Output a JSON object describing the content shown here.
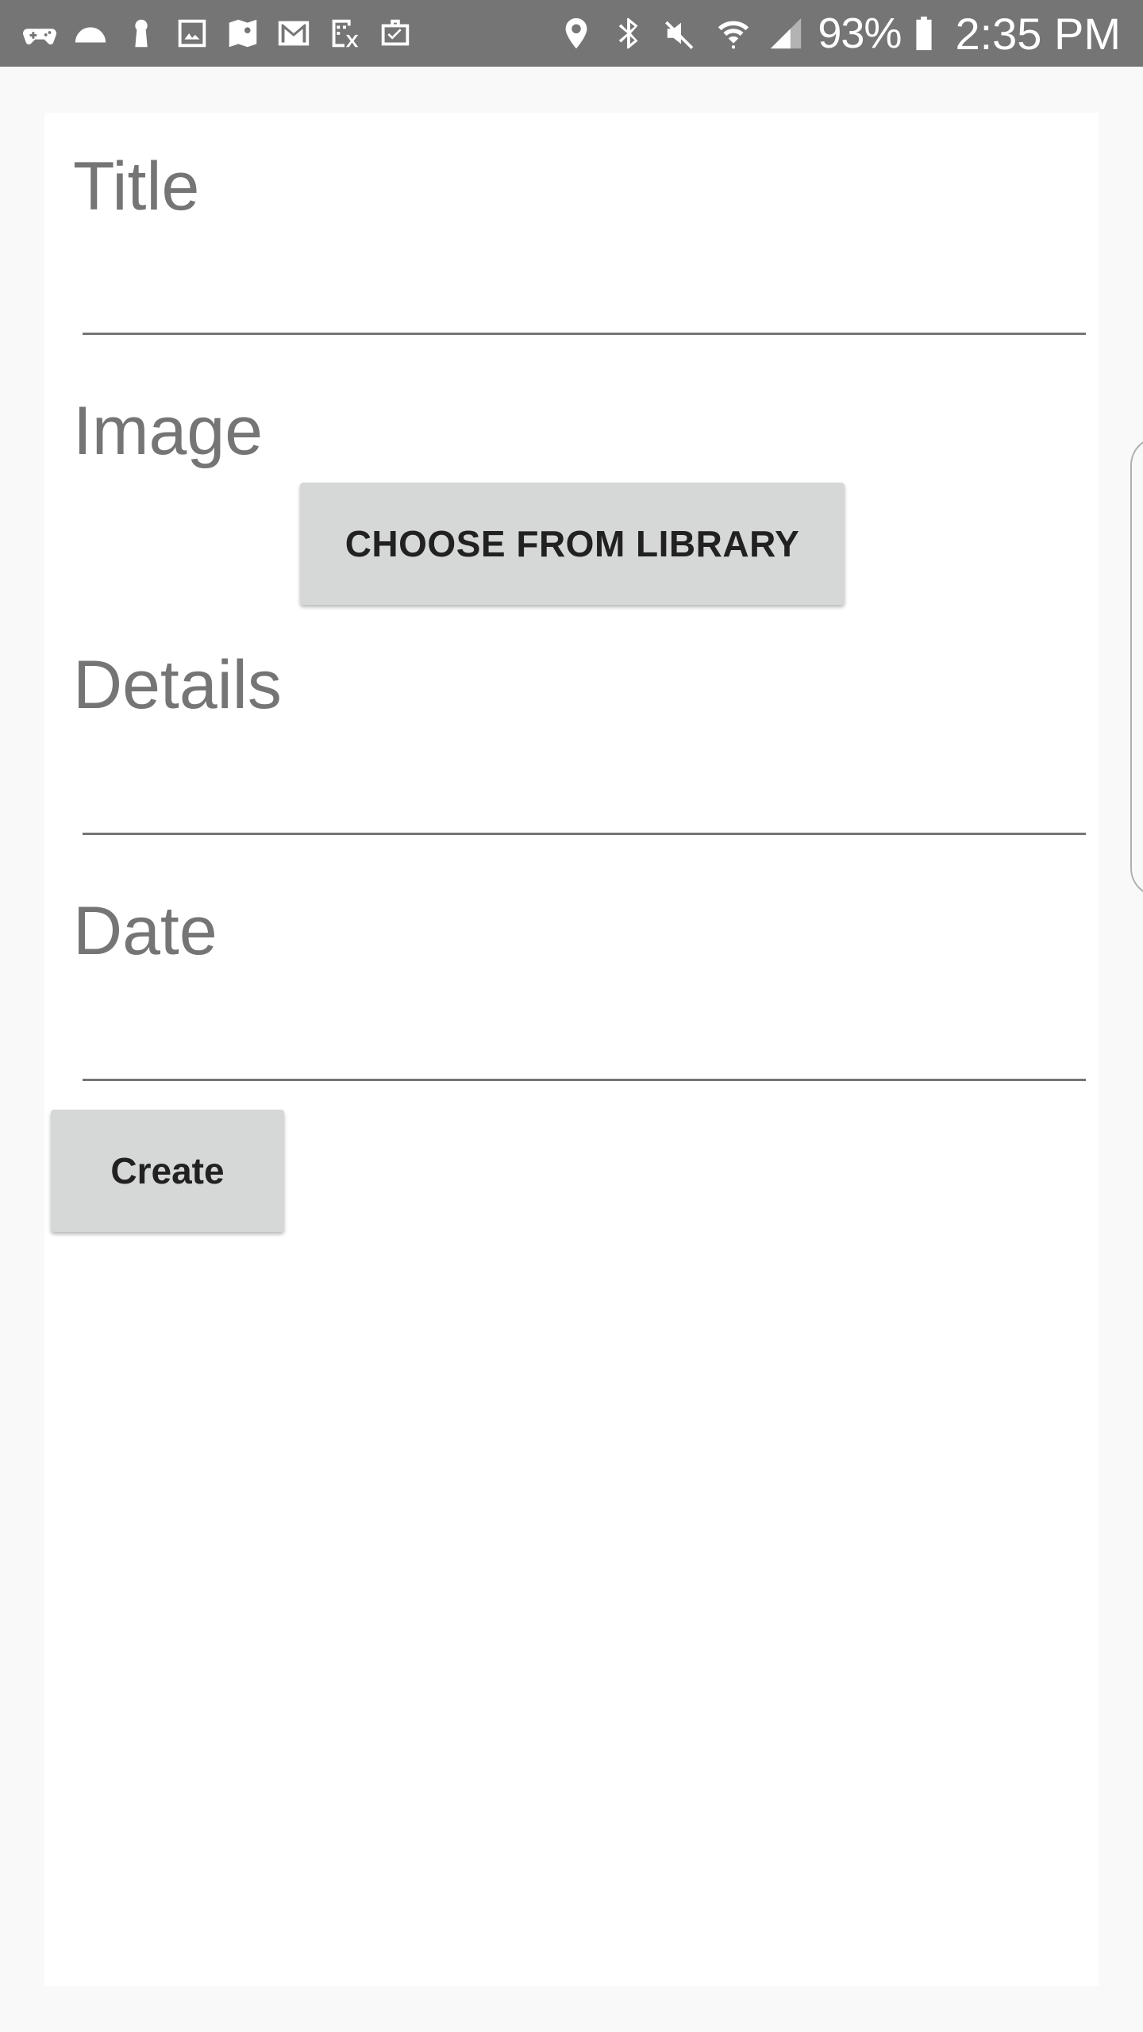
{
  "status_bar": {
    "left_icons": [
      "game-controller-icon",
      "cloud-icon",
      "keyhole-icon",
      "image-icon",
      "maps-icon",
      "gmail-icon",
      "calendar-icon",
      "briefcase-icon"
    ],
    "right_icons": [
      "location-icon",
      "bluetooth-icon",
      "mute-icon",
      "wifi-icon",
      "signal-icon",
      "battery-icon"
    ],
    "battery_percent": "93%",
    "time": "2:35 PM"
  },
  "form": {
    "title_label": "Title",
    "image_label": "Image",
    "choose_button_label": "CHOOSE FROM LIBRARY",
    "details_label": "Details",
    "date_label": "Date",
    "create_button_label": "Create"
  },
  "colors": {
    "status_bar_bg": "#757575",
    "label_text": "#757575",
    "button_bg": "#d6d7d7",
    "button_text": "#212121"
  }
}
